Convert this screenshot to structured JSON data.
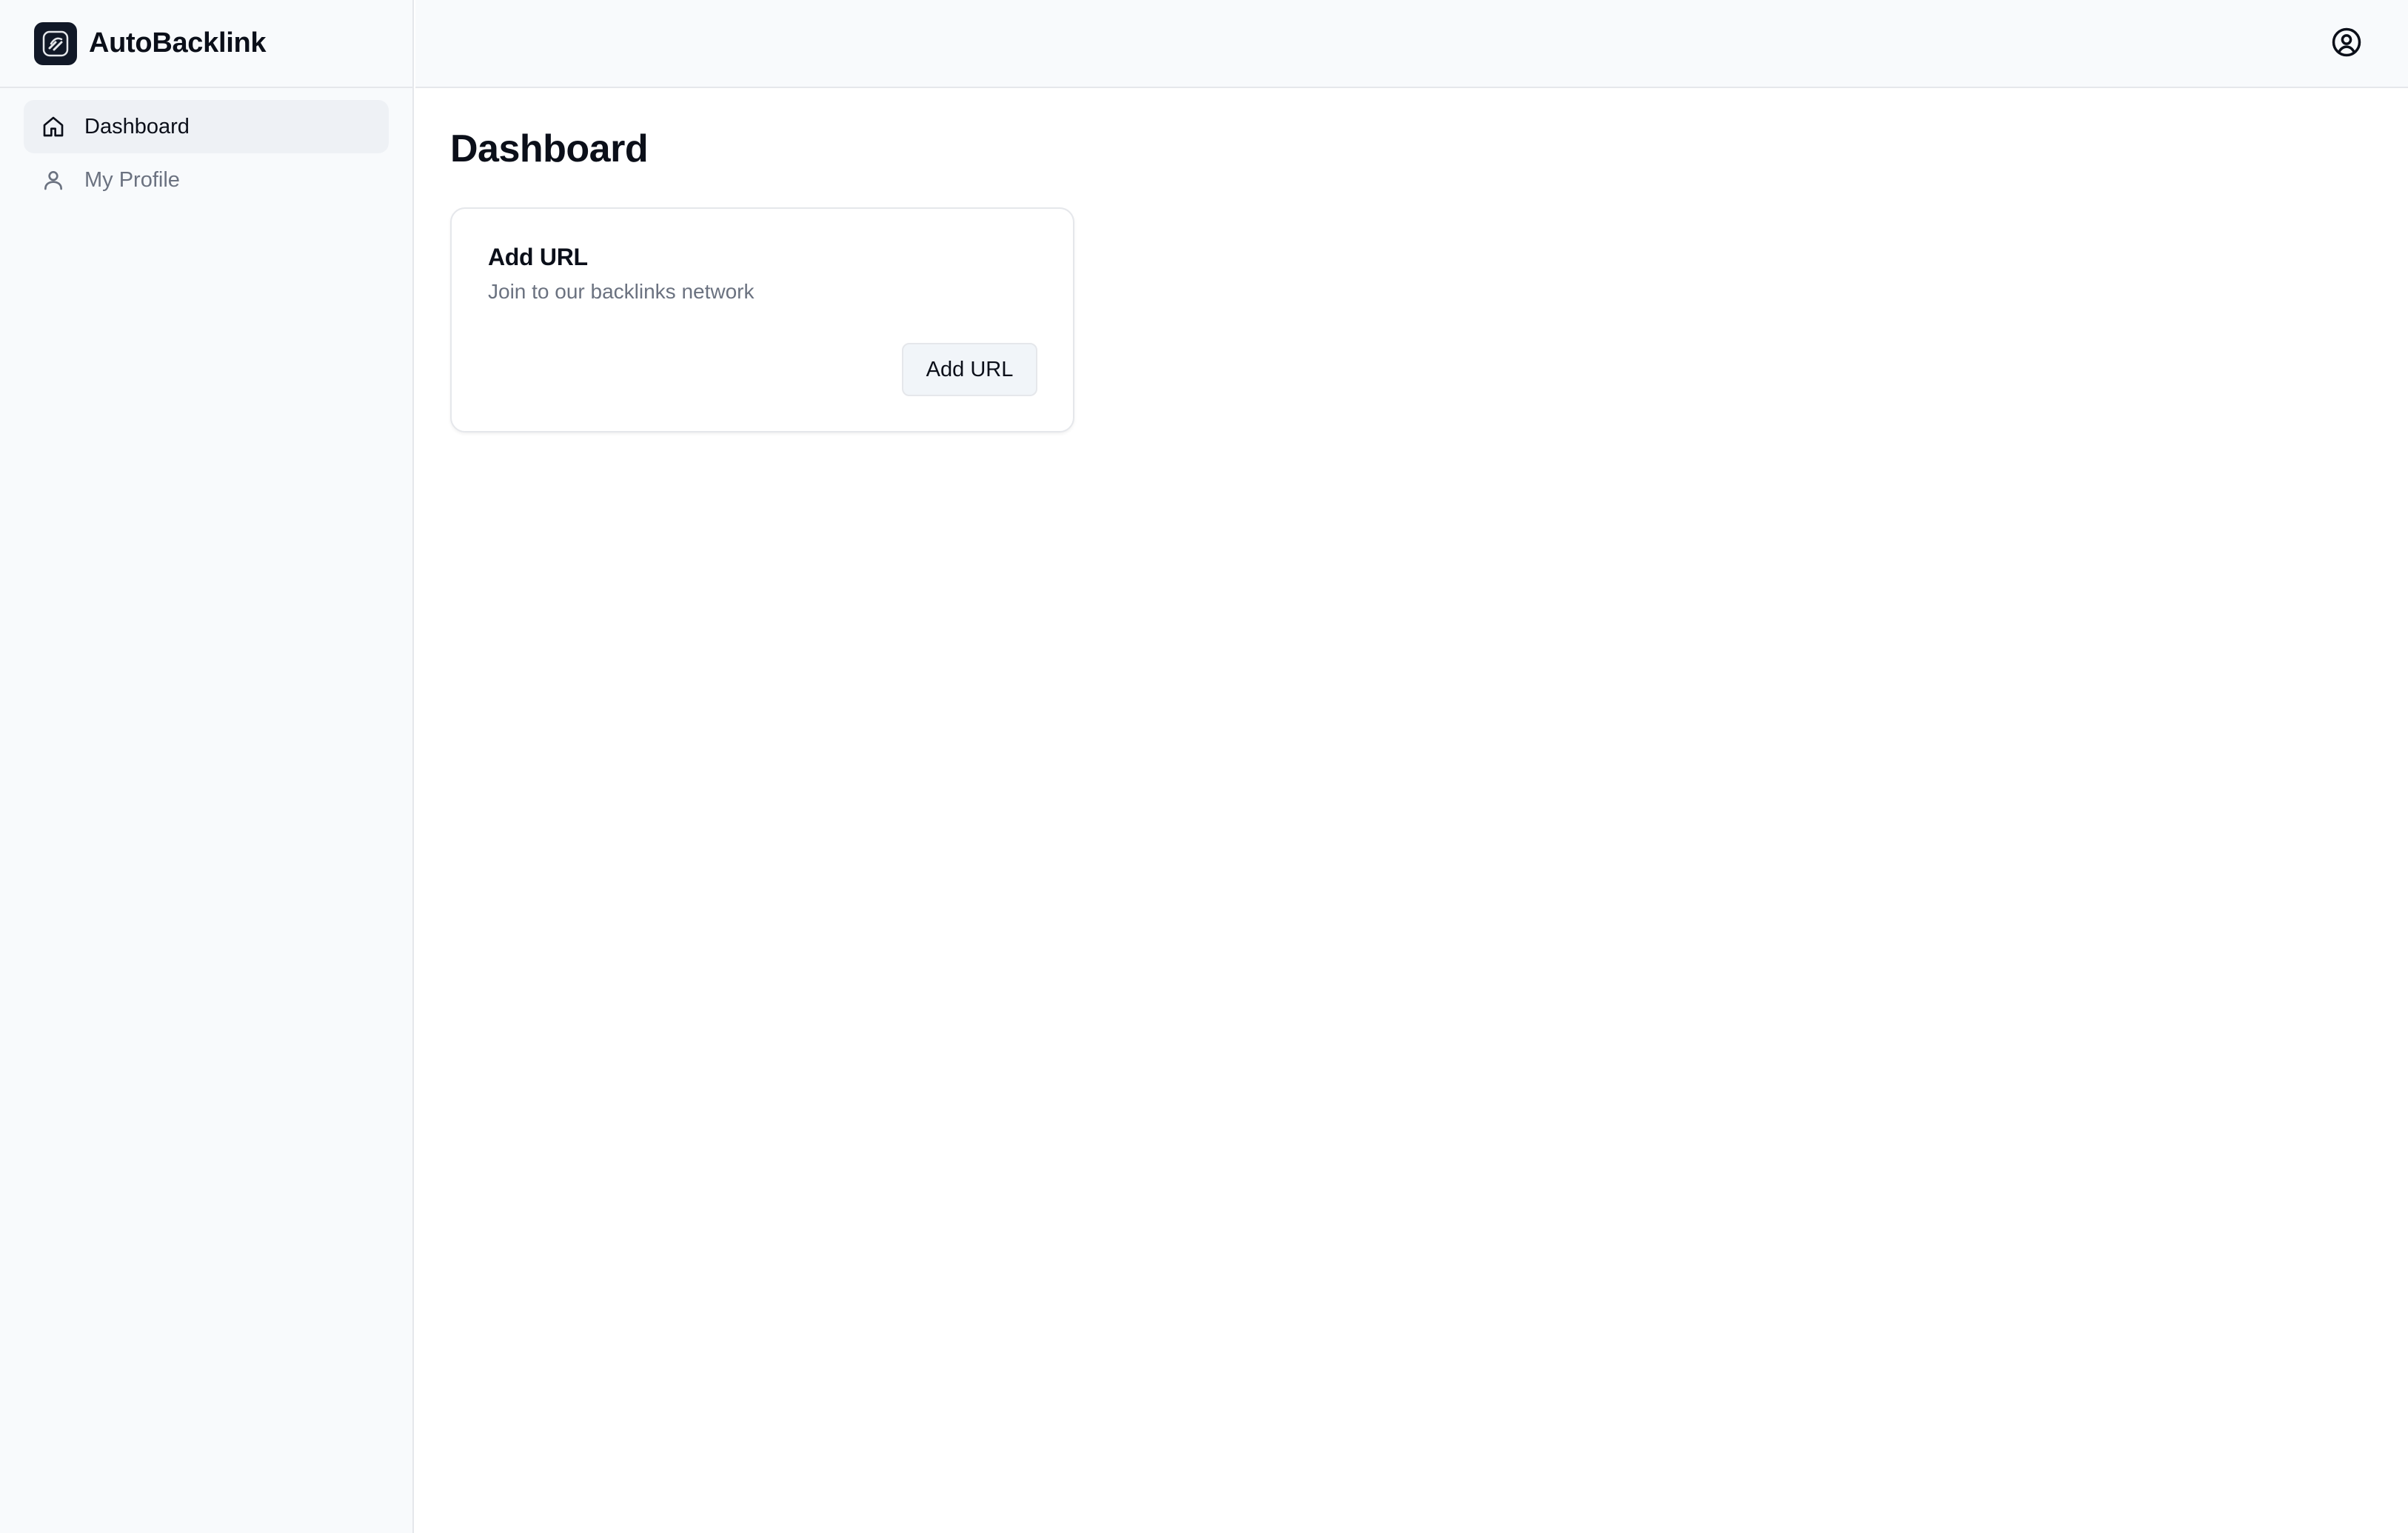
{
  "app": {
    "name": "AutoBacklink"
  },
  "icons": {
    "logo": "chain-link-logo-icon",
    "account": "user-circle-icon",
    "home": "home-icon",
    "profile": "user-icon"
  },
  "sidebar": {
    "items": [
      {
        "label": "Dashboard",
        "icon": "home-icon",
        "active": true
      },
      {
        "label": "My Profile",
        "icon": "user-icon",
        "active": false
      }
    ]
  },
  "main": {
    "title": "Dashboard",
    "card": {
      "title": "Add URL",
      "subtitle": "Join to our backlinks network",
      "button_label": "Add URL"
    }
  },
  "colors": {
    "sidebar_bg": "#f8fafc",
    "active_bg": "#eef1f5",
    "muted_text": "#6b7280",
    "border": "#e5e7eb"
  }
}
